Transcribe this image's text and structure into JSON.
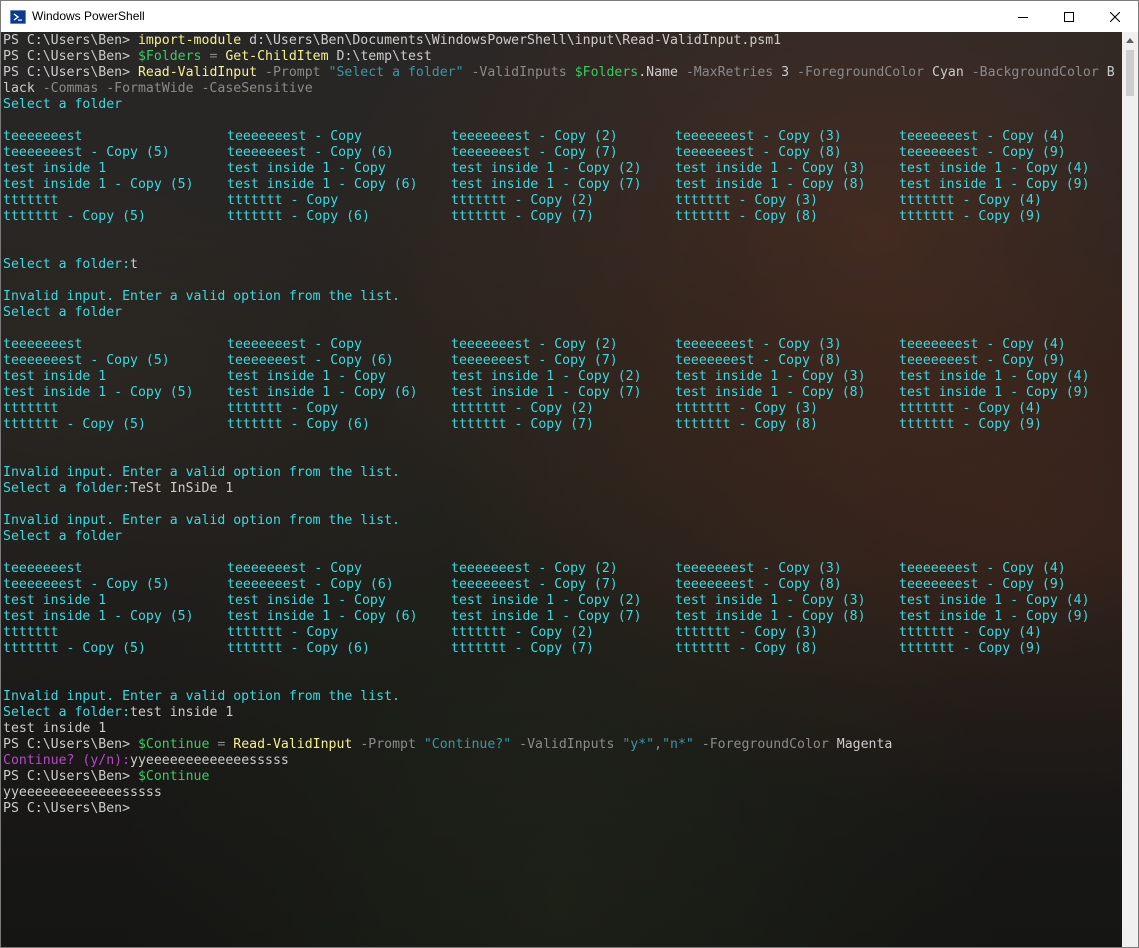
{
  "window": {
    "title": "Windows PowerShell"
  },
  "colors": {
    "default": "#cccccc",
    "cyan": "#3ad9e0",
    "command": "#f5f18c",
    "parameter": "#8a8a8a",
    "string": "#3a96a8",
    "variable": "#39cc5f",
    "magenta": "#b648c8"
  },
  "icons": [
    "powershell-icon",
    "minimize-icon",
    "maximize-icon",
    "close-icon",
    "scroll-up-arrow-icon"
  ],
  "terminal": {
    "lines": [
      [
        [
          "PS C:\\Users\\Ben> ",
          "default"
        ],
        [
          "import-module",
          "command"
        ],
        [
          " d:\\Users\\Ben\\Documents\\WindowsPowerShell\\input\\Read-ValidInput.psm1",
          "default"
        ]
      ],
      [
        [
          "PS C:\\Users\\Ben> ",
          "default"
        ],
        [
          "$Folders",
          "variable"
        ],
        [
          " = ",
          "parameter"
        ],
        [
          "Get-ChildItem",
          "command"
        ],
        [
          " D:\\temp\\test",
          "default"
        ]
      ],
      [
        [
          "PS C:\\Users\\Ben> ",
          "default"
        ],
        [
          "Read-ValidInput",
          "command"
        ],
        [
          " -Prompt ",
          "parameter"
        ],
        [
          "\"Select a folder\"",
          "string"
        ],
        [
          " -ValidInputs ",
          "parameter"
        ],
        [
          "$Folders",
          "variable"
        ],
        [
          ".Name",
          "default"
        ],
        [
          " -MaxRetries ",
          "parameter"
        ],
        [
          "3",
          "default"
        ],
        [
          " -ForegroundColor ",
          "parameter"
        ],
        [
          "Cyan",
          "default"
        ],
        [
          " -BackgroundColor ",
          "parameter"
        ],
        [
          "B",
          "default"
        ]
      ],
      [
        [
          "lack",
          "default"
        ],
        [
          " -Commas -FormatWide -CaseSensitive",
          "parameter"
        ]
      ],
      [
        [
          "Select a folder",
          "cyan"
        ]
      ],
      [],
      {
        "grid": 0
      },
      [],
      [],
      [
        [
          "Select a folder:",
          "cyan"
        ],
        [
          "t",
          "default"
        ]
      ],
      [],
      [
        [
          "Invalid input. Enter a valid option from the list.",
          "cyan"
        ]
      ],
      [
        [
          "Select a folder",
          "cyan"
        ]
      ],
      [],
      {
        "grid": 1
      },
      [],
      [],
      [
        [
          "Invalid input. Enter a valid option from the list.",
          "cyan"
        ]
      ],
      [
        [
          "Select a folder:",
          "cyan"
        ],
        [
          "TeSt InSiDe 1",
          "default"
        ]
      ],
      [],
      [
        [
          "Invalid input. Enter a valid option from the list.",
          "cyan"
        ]
      ],
      [
        [
          "Select a folder",
          "cyan"
        ]
      ],
      [],
      {
        "grid": 2
      },
      [],
      [],
      [
        [
          "Invalid input. Enter a valid option from the list.",
          "cyan"
        ]
      ],
      [
        [
          "Select a folder:",
          "cyan"
        ],
        [
          "test inside 1",
          "default"
        ]
      ],
      [
        [
          "test inside 1",
          "default"
        ]
      ],
      [
        [
          "PS C:\\Users\\Ben> ",
          "default"
        ],
        [
          "$Continue",
          "variable"
        ],
        [
          " = ",
          "parameter"
        ],
        [
          "Read-ValidInput",
          "command"
        ],
        [
          " -Prompt ",
          "parameter"
        ],
        [
          "\"Continue?\"",
          "string"
        ],
        [
          " -ValidInputs ",
          "parameter"
        ],
        [
          "\"y*\"",
          "string"
        ],
        [
          ",",
          "parameter"
        ],
        [
          "\"n*\"",
          "string"
        ],
        [
          " -ForegroundColor ",
          "parameter"
        ],
        [
          "Magenta",
          "default"
        ]
      ],
      [
        [
          "Continue? (y/n):",
          "magenta"
        ],
        [
          "yyeeeeeeeeeeeeesssss",
          "default"
        ]
      ],
      [
        [
          "PS C:\\Users\\Ben> ",
          "default"
        ],
        [
          "$Continue",
          "variable"
        ]
      ],
      [
        [
          "yyeeeeeeeeeeeeesssss",
          "default"
        ]
      ],
      [
        [
          "PS C:\\Users\\Ben>",
          "default"
        ]
      ]
    ],
    "option_grids": [
      [
        [
          "teeeeeeest",
          "teeeeeeest - Copy",
          "teeeeeeest - Copy (2)",
          "teeeeeeest - Copy (3)",
          "teeeeeeest - Copy (4)"
        ],
        [
          "teeeeeeest - Copy (5)",
          "teeeeeeest - Copy (6)",
          "teeeeeeest - Copy (7)",
          "teeeeeeest - Copy (8)",
          "teeeeeeest - Copy (9)"
        ],
        [
          "test inside 1",
          "test inside 1 - Copy",
          "test inside 1 - Copy (2)",
          "test inside 1 - Copy (3)",
          "test inside 1 - Copy (4)"
        ],
        [
          "test inside 1 - Copy (5)",
          "test inside 1 - Copy (6)",
          "test inside 1 - Copy (7)",
          "test inside 1 - Copy (8)",
          "test inside 1 - Copy (9)"
        ],
        [
          "ttttttt",
          "ttttttt - Copy",
          "ttttttt - Copy (2)",
          "ttttttt - Copy (3)",
          "ttttttt - Copy (4)"
        ],
        [
          "ttttttt - Copy (5)",
          "ttttttt - Copy (6)",
          "ttttttt - Copy (7)",
          "ttttttt - Copy (8)",
          "ttttttt - Copy (9)"
        ]
      ],
      [
        [
          "teeeeeeest",
          "teeeeeeest - Copy",
          "teeeeeeest - Copy (2)",
          "teeeeeeest - Copy (3)",
          "teeeeeeest - Copy (4)"
        ],
        [
          "teeeeeeest - Copy (5)",
          "teeeeeeest - Copy (6)",
          "teeeeeeest - Copy (7)",
          "teeeeeeest - Copy (8)",
          "teeeeeeest - Copy (9)"
        ],
        [
          "test inside 1",
          "test inside 1 - Copy",
          "test inside 1 - Copy (2)",
          "test inside 1 - Copy (3)",
          "test inside 1 - Copy (4)"
        ],
        [
          "test inside 1 - Copy (5)",
          "test inside 1 - Copy (6)",
          "test inside 1 - Copy (7)",
          "test inside 1 - Copy (8)",
          "test inside 1 - Copy (9)"
        ],
        [
          "ttttttt",
          "ttttttt - Copy",
          "ttttttt - Copy (2)",
          "ttttttt - Copy (3)",
          "ttttttt - Copy (4)"
        ],
        [
          "ttttttt - Copy (5)",
          "ttttttt - Copy (6)",
          "ttttttt - Copy (7)",
          "ttttttt - Copy (8)",
          "ttttttt - Copy (9)"
        ]
      ],
      [
        [
          "teeeeeeest",
          "teeeeeeest - Copy",
          "teeeeeeest - Copy (2)",
          "teeeeeeest - Copy (3)",
          "teeeeeeest - Copy (4)"
        ],
        [
          "teeeeeeest - Copy (5)",
          "teeeeeeest - Copy (6)",
          "teeeeeeest - Copy (7)",
          "teeeeeeest - Copy (8)",
          "teeeeeeest - Copy (9)"
        ],
        [
          "test inside 1",
          "test inside 1 - Copy",
          "test inside 1 - Copy (2)",
          "test inside 1 - Copy (3)",
          "test inside 1 - Copy (4)"
        ],
        [
          "test inside 1 - Copy (5)",
          "test inside 1 - Copy (6)",
          "test inside 1 - Copy (7)",
          "test inside 1 - Copy (8)",
          "test inside 1 - Copy (9)"
        ],
        [
          "ttttttt",
          "ttttttt - Copy",
          "ttttttt - Copy (2)",
          "ttttttt - Copy (3)",
          "ttttttt - Copy (4)"
        ],
        [
          "ttttttt - Copy (5)",
          "ttttttt - Copy (6)",
          "ttttttt - Copy (7)",
          "ttttttt - Copy (8)",
          "ttttttt - Copy (9)"
        ]
      ]
    ]
  }
}
